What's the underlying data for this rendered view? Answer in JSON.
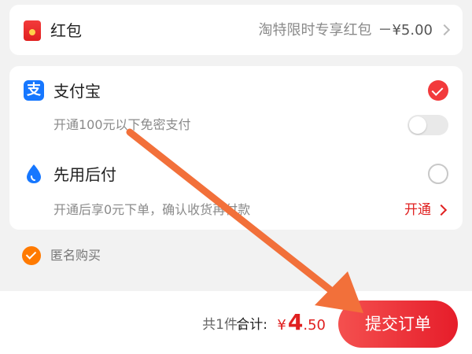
{
  "hongbao": {
    "icon": "red-packet-icon",
    "label": "红包",
    "value": "淘特限时专享红包",
    "amount": "－¥5.00"
  },
  "payment": {
    "alipay": {
      "icon": "alipay-icon",
      "icon_glyph": "支",
      "label": "支付宝",
      "subtitle": "开通100元以下免密支付",
      "selected": true
    },
    "pay_later": {
      "icon": "water-drop-icon",
      "label": "先用后付",
      "subtitle": "开通后享0元下单，确认收货再付款",
      "link": "开通",
      "selected": false
    }
  },
  "anonymous": {
    "label": "匿名购买",
    "checked": true
  },
  "bottom": {
    "count": "共1件，",
    "total_label": "合计:",
    "currency": "¥",
    "price_int": "4",
    "price_dec": ".50",
    "submit_label": "提交订单"
  },
  "colors": {
    "accent_red": "#e02020",
    "alipay_blue": "#1677ff",
    "anonymous_orange": "#ff7a00",
    "annotation_arrow": "#f2703a"
  }
}
